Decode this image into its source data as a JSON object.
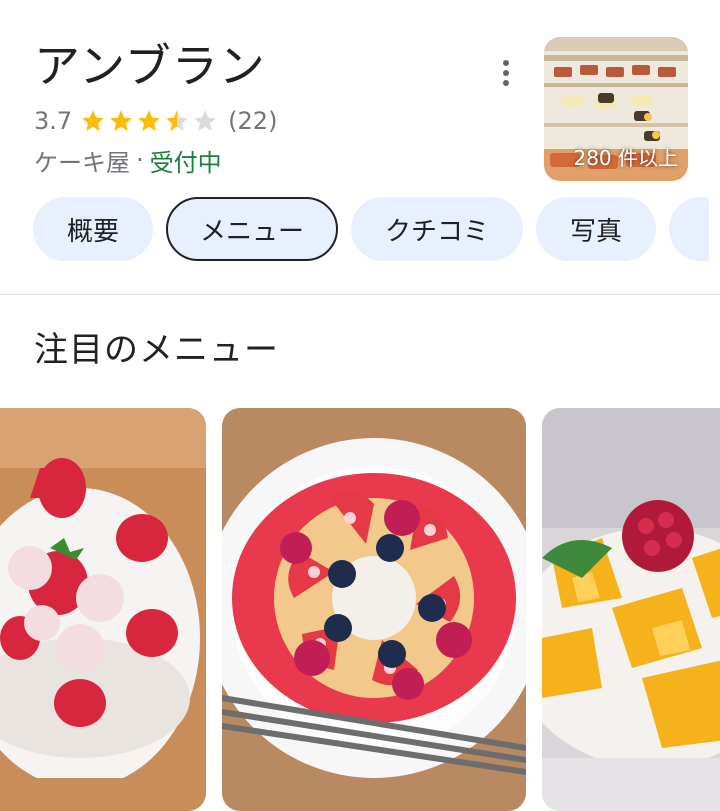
{
  "place": {
    "name": "アンブラン",
    "rating": "3.7",
    "stars_filled_fraction": 0.74,
    "review_count": "(22)",
    "category": "ケーキ屋",
    "separator": "·",
    "status": "受付中",
    "status_color": "#188038"
  },
  "photos": {
    "count_label": "280 件以上"
  },
  "tabs": [
    {
      "label": "概要",
      "selected": false
    },
    {
      "label": "メニュー",
      "selected": true
    },
    {
      "label": "クチコミ",
      "selected": false
    },
    {
      "label": "写真",
      "selected": false
    }
  ],
  "featured": {
    "title": "注目のメニュー",
    "items": [
      {
        "image": "strawberry-parfait-photo"
      },
      {
        "image": "berry-ring-cake-photo"
      },
      {
        "image": "mango-raspberry-dessert-photo"
      }
    ]
  },
  "colors": {
    "star": "#fbbc04",
    "star_empty": "#dadce0",
    "chip_bg": "#e8f0fe",
    "text_secondary": "#70757a"
  },
  "icons": {
    "more": "more-vert-icon",
    "star": "star-icon"
  }
}
